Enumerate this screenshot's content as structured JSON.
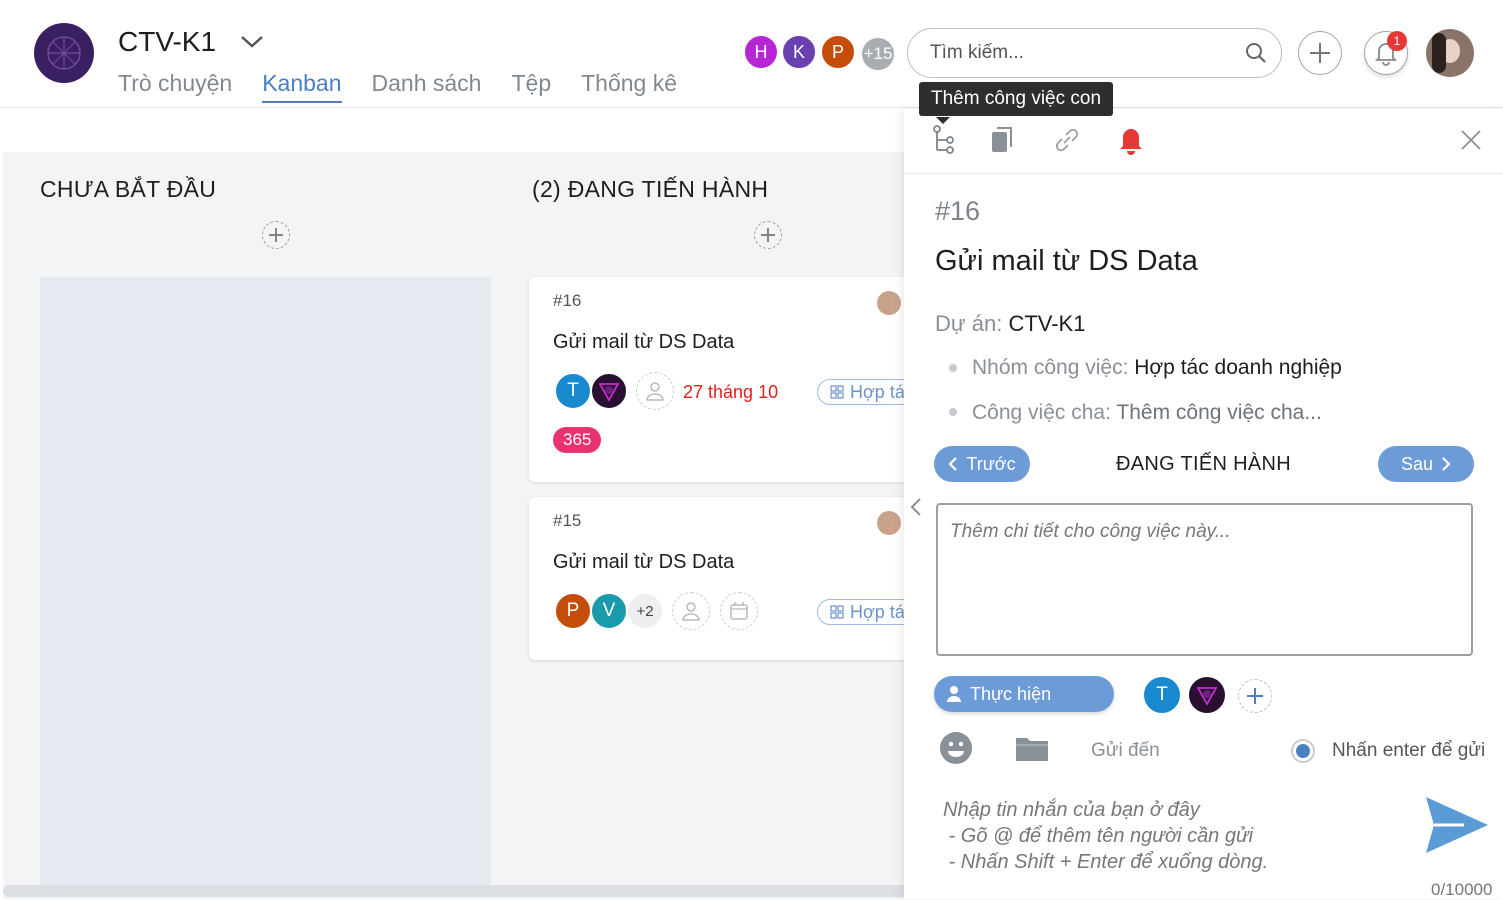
{
  "header": {
    "project_name": "CTV-K1",
    "tabs": [
      {
        "label": "Trò chuyện",
        "active": false
      },
      {
        "label": "Kanban",
        "active": true
      },
      {
        "label": "Danh sách",
        "active": false
      },
      {
        "label": "Tệp",
        "active": false
      },
      {
        "label": "Thống kê",
        "active": false
      }
    ],
    "members": [
      {
        "initial": "H",
        "color": "#b626d4"
      },
      {
        "initial": "K",
        "color": "#6a3fb0"
      },
      {
        "initial": "P",
        "color": "#c44d0c"
      }
    ],
    "more_members": "+15",
    "search_placeholder": "Tìm kiếm...",
    "notification_count": "1"
  },
  "board": {
    "columns": [
      {
        "title": "CHƯA BẮT ĐẦU"
      },
      {
        "title": "(2) ĐANG TIẾN HÀNH"
      }
    ],
    "cards": [
      {
        "id": "#16",
        "title": "Gửi mail từ DS Data",
        "assignees": [
          {
            "initial": "T",
            "color": "#1a8ad0"
          },
          {
            "initial": "",
            "color": "#2a1030"
          }
        ],
        "due": "27 tháng 10",
        "group": "Hợp tá",
        "tag": "365"
      },
      {
        "id": "#15",
        "title": "Gửi mail từ DS Data",
        "assignees": [
          {
            "initial": "P",
            "color": "#c44d0c"
          },
          {
            "initial": "V",
            "color": "#1b9aab"
          }
        ],
        "more_assignees": "+2",
        "group": "Hợp tá"
      }
    ]
  },
  "panel": {
    "tooltip": "Thêm công việc con",
    "task_id": "#16",
    "task_title": "Gửi mail từ DS Data",
    "project_label": "Dự án:",
    "project_value": "CTV-K1",
    "group_label": "Nhóm công việc:",
    "group_value": "Hợp tác doanh nghiệp",
    "parent_label": "Công việc cha:",
    "parent_value": "Thêm công việc cha...",
    "prev_label": "Trước",
    "next_label": "Sau",
    "status": "ĐANG TIẾN HÀNH",
    "detail_placeholder": "Thêm chi tiết cho công việc này...",
    "assign_label": "Thực hiện",
    "assignees": [
      {
        "initial": "T",
        "color": "#1a8ad0"
      },
      {
        "initial": "",
        "color": "#2a1030"
      }
    ],
    "send_to_label": "Gửi đến",
    "enter_send_label": "Nhấn enter để gửi",
    "message_hint": "Nhập tin nhắn của bạn ở đây\n - Gõ @ để thêm tên người cần gửi\n - Nhấn Shift + Enter để xuống dòng.",
    "char_counter": "0/10000"
  },
  "colors": {
    "accent": "#4a7fc1",
    "pill": "#6c9bd8",
    "due_red": "#e02020",
    "tag_pink": "#e8336f"
  }
}
